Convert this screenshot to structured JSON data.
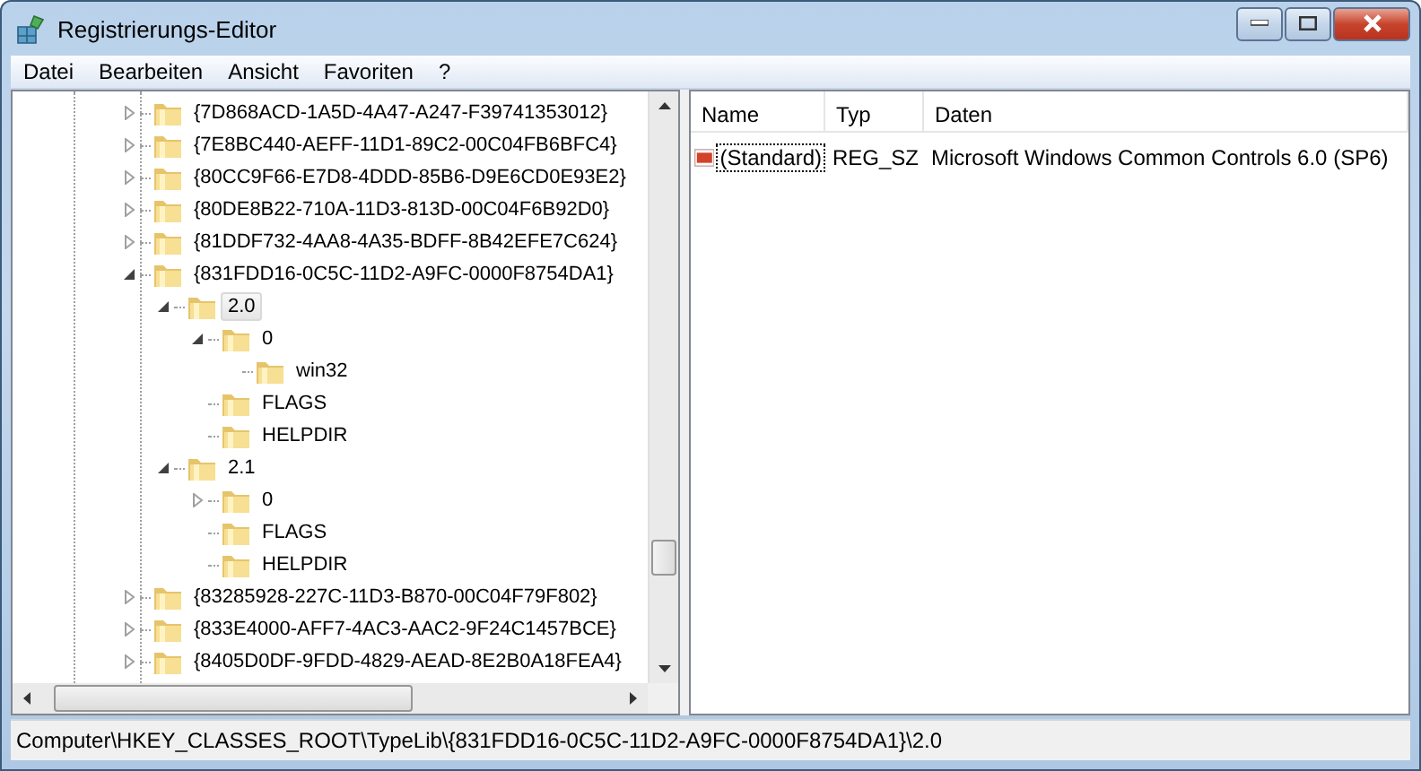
{
  "window": {
    "title": "Registrierungs-Editor"
  },
  "menu": [
    "Datei",
    "Bearbeiten",
    "Ansicht",
    "Favoriten",
    "?"
  ],
  "tree": [
    {
      "label": "{7D868ACD-1A5D-4A47-A247-F39741353012}",
      "expanded": false,
      "selected": false
    },
    {
      "label": "{7E8BC440-AEFF-11D1-89C2-00C04FB6BFC4}",
      "expanded": false,
      "selected": false
    },
    {
      "label": "{80CC9F66-E7D8-4DDD-85B6-D9E6CD0E93E2}",
      "expanded": false,
      "selected": false
    },
    {
      "label": "{80DE8B22-710A-11D3-813D-00C04F6B92D0}",
      "expanded": false,
      "selected": false
    },
    {
      "label": "{81DDF732-4AA8-4A35-BDFF-8B42EFE7C624}",
      "expanded": false,
      "selected": false
    },
    {
      "label": "{831FDD16-0C5C-11D2-A9FC-0000F8754DA1}",
      "expanded": true,
      "selected": false,
      "children": [
        {
          "label": "2.0",
          "expanded": true,
          "selected": true,
          "children": [
            {
              "label": "0",
              "expanded": true,
              "selected": false,
              "children": [
                {
                  "label": "win32",
                  "selected": false
                }
              ]
            },
            {
              "label": "FLAGS",
              "selected": false
            },
            {
              "label": "HELPDIR",
              "selected": false
            }
          ]
        },
        {
          "label": "2.1",
          "expanded": true,
          "selected": false,
          "children": [
            {
              "label": "0",
              "expanded": false,
              "selected": false
            },
            {
              "label": "FLAGS",
              "selected": false
            },
            {
              "label": "HELPDIR",
              "selected": false
            }
          ]
        }
      ]
    },
    {
      "label": "{83285928-227C-11D3-B870-00C04F79F802}",
      "expanded": false,
      "selected": false
    },
    {
      "label": "{833E4000-AFF7-4AC3-AAC2-9F24C1457BCE}",
      "expanded": false,
      "selected": false
    },
    {
      "label": "{8405D0DF-9FDD-4829-AEAD-8E2B0A18FEA4}",
      "expanded": false,
      "selected": false
    }
  ],
  "values": {
    "columns": [
      "Name",
      "Typ",
      "Daten"
    ],
    "rows": [
      {
        "name": "(Standard)",
        "type": "REG_SZ",
        "data": "Microsoft Windows Common Controls 6.0 (SP6)",
        "kind": "string",
        "focused": true
      }
    ]
  },
  "status_bar": "Computer\\HKEY_CLASSES_ROOT\\TypeLib\\{831FDD16-0C5C-11D2-A9FC-0000F8754DA1}\\2.0"
}
